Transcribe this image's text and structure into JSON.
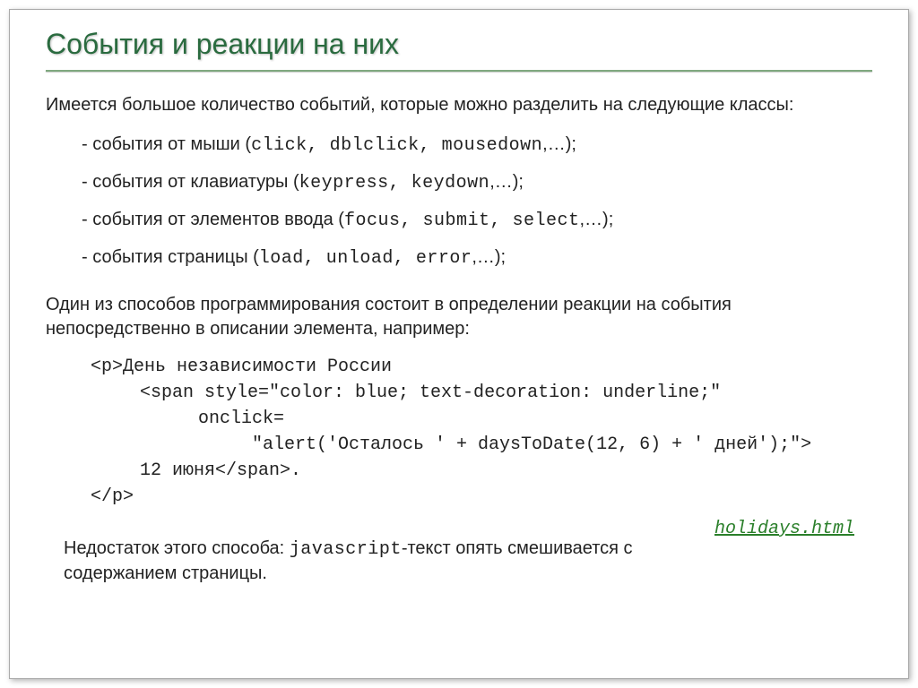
{
  "title": "События и реакции на них",
  "intro": "Имеется большое количество событий, которые можно разделить на следующие классы:",
  "events": [
    {
      "label": "- события от мыши (",
      "items": "click, dblclick, mousedown",
      "tail": ",…);"
    },
    {
      "label": "- события от клавиатуры (",
      "items": "keypress, keydown",
      "tail": ",…);"
    },
    {
      "label": "- события от элементов ввода (",
      "items": "focus, submit, select",
      "tail": ",…);"
    },
    {
      "label": "- события страницы (",
      "items": "load, unload, error",
      "tail": ",…);"
    }
  ],
  "method": "Один из способов программирования состоит в определении реакции на события непосредственно в описании элемента, например:",
  "code": {
    "l1": "<p>День независимости России",
    "l2": "<span style=\"color: blue; text-decoration: underline;\"",
    "l3": "onclick=",
    "l4": "\"alert('Осталось ' + daysToDate(12, 6) + ' дней');\">",
    "l5": "12 июня</span>.",
    "l6": "</p>"
  },
  "disadvantage": {
    "pre": "Недостаток этого способа: ",
    "code": "javascript",
    "post": "-текст опять смешивается с содержанием страницы."
  },
  "link": "holidays.html"
}
